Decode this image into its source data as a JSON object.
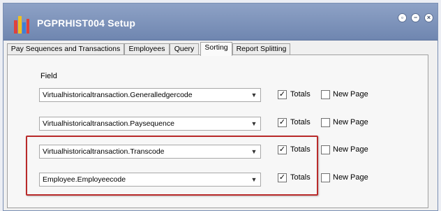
{
  "window": {
    "title": "PGPRHIST004 Setup"
  },
  "tabs": [
    {
      "label": "Pay Sequences and Transactions"
    },
    {
      "label": "Employees"
    },
    {
      "label": "Query"
    },
    {
      "label": "Sorting"
    },
    {
      "label": "Report Splitting"
    }
  ],
  "active_tab": "Sorting",
  "sorting": {
    "field_header": "Field",
    "rows": [
      {
        "field": "Virtualhistoricaltransaction.Generalledgercode",
        "totals_label": "Totals",
        "totals_checked": true,
        "newpage_label": "New Page",
        "newpage_checked": false
      },
      {
        "field": "Virtualhistoricaltransaction.Paysequence",
        "totals_label": "Totals",
        "totals_checked": true,
        "newpage_label": "New Page",
        "newpage_checked": false
      },
      {
        "field": "Virtualhistoricaltransaction.Transcode",
        "totals_label": "Totals",
        "totals_checked": true,
        "newpage_label": "New Page",
        "newpage_checked": false
      },
      {
        "field": "Employee.Employeecode",
        "totals_label": "Totals",
        "totals_checked": true,
        "newpage_label": "New Page",
        "newpage_checked": false
      }
    ]
  },
  "colors": {
    "titlebar": "#7a90b8",
    "highlight": "#b92a2a"
  },
  "icons": {
    "app": "bar-chart-icon",
    "restore": "restore-icon",
    "minimize": "minimize-icon",
    "close": "close-icon",
    "dropdown": "chevron-down-icon",
    "check": "check-mark"
  }
}
